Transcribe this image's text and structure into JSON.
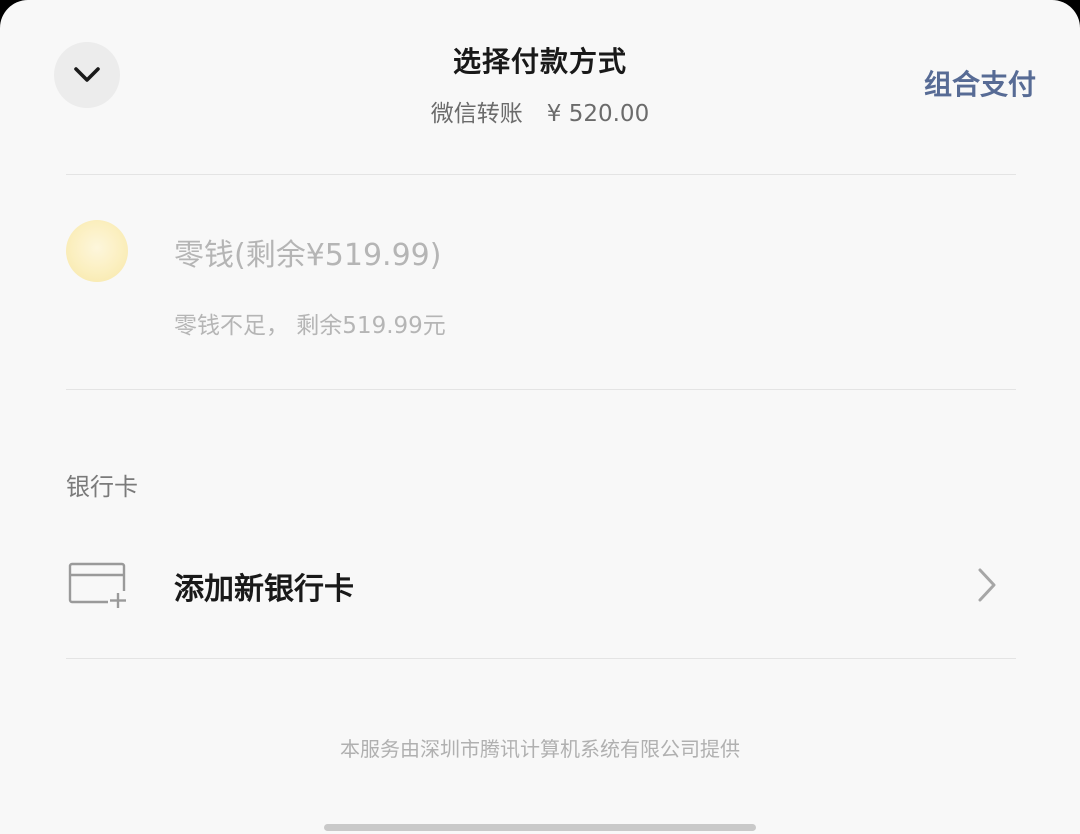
{
  "header": {
    "title": "选择付款方式",
    "subtitle_label": "微信转账",
    "subtitle_amount": "¥ 520.00",
    "combo_label": "组合支付"
  },
  "wallet": {
    "label": "零钱(剩余¥519.99)",
    "note": "零钱不足， 剩余519.99元",
    "enabled": false
  },
  "bank": {
    "section_title": "银行卡",
    "add_label": "添加新银行卡"
  },
  "footer": {
    "text": "本服务由深圳市腾讯计算机系统有限公司提供"
  },
  "icons": {
    "collapse": "chevron-down-icon",
    "wallet": "coin-icon",
    "card": "card-add-icon",
    "arrow": "chevron-right-icon"
  },
  "colors": {
    "accent": "#576b95",
    "background": "#f8f8f8",
    "disabled_text": "#b5b5b5",
    "coin": "#fbefbf"
  }
}
